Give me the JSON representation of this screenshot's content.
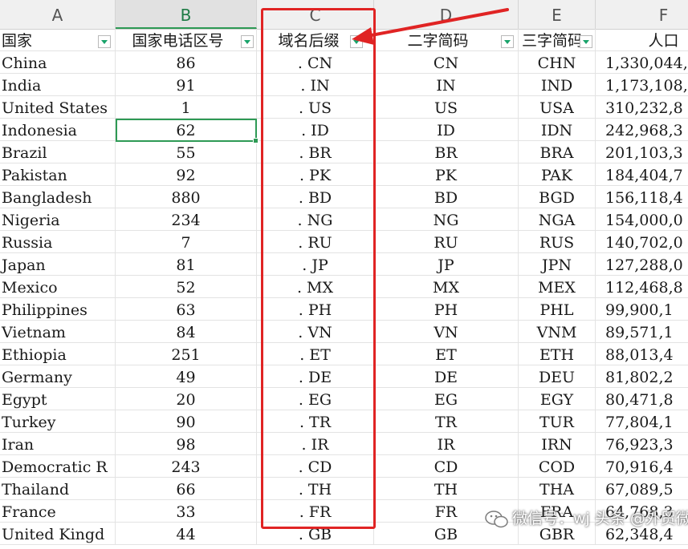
{
  "columns": [
    "A",
    "B",
    "C",
    "D",
    "E",
    "F"
  ],
  "selected_column": "B",
  "header_row": {
    "a": "国家",
    "b": "国家电话区号",
    "c": "域名后缀",
    "d": "二字简码",
    "e": "三字简码",
    "f": "人口"
  },
  "rows": [
    {
      "country": "China",
      "code": "86",
      "domain": ". CN",
      "iso2": "CN",
      "iso3": "CHN",
      "population": "1,330,044,"
    },
    {
      "country": "India",
      "code": "91",
      "domain": ". IN",
      "iso2": "IN",
      "iso3": "IND",
      "population": "1,173,108,"
    },
    {
      "country": "United States",
      "code": "1",
      "domain": ". US",
      "iso2": "US",
      "iso3": "USA",
      "population": "310,232,8"
    },
    {
      "country": "Indonesia",
      "code": "62",
      "domain": ". ID",
      "iso2": "ID",
      "iso3": "IDN",
      "population": "242,968,3"
    },
    {
      "country": "Brazil",
      "code": "55",
      "domain": ". BR",
      "iso2": "BR",
      "iso3": "BRA",
      "population": "201,103,3"
    },
    {
      "country": "Pakistan",
      "code": "92",
      "domain": ". PK",
      "iso2": "PK",
      "iso3": "PAK",
      "population": "184,404,7"
    },
    {
      "country": "Bangladesh",
      "code": "880",
      "domain": ". BD",
      "iso2": "BD",
      "iso3": "BGD",
      "population": "156,118,4"
    },
    {
      "country": "Nigeria",
      "code": "234",
      "domain": ". NG",
      "iso2": "NG",
      "iso3": "NGA",
      "population": "154,000,0"
    },
    {
      "country": "Russia",
      "code": "7",
      "domain": ". RU",
      "iso2": "RU",
      "iso3": "RUS",
      "population": "140,702,0"
    },
    {
      "country": "Japan",
      "code": "81",
      "domain": ". JP",
      "iso2": "JP",
      "iso3": "JPN",
      "population": "127,288,0"
    },
    {
      "country": "Mexico",
      "code": "52",
      "domain": ". MX",
      "iso2": "MX",
      "iso3": "MEX",
      "population": "112,468,8"
    },
    {
      "country": "Philippines",
      "code": "63",
      "domain": ". PH",
      "iso2": "PH",
      "iso3": "PHL",
      "population": "99,900,1"
    },
    {
      "country": "Vietnam",
      "code": "84",
      "domain": ". VN",
      "iso2": "VN",
      "iso3": "VNM",
      "population": "89,571,1"
    },
    {
      "country": "Ethiopia",
      "code": "251",
      "domain": ". ET",
      "iso2": "ET",
      "iso3": "ETH",
      "population": "88,013,4"
    },
    {
      "country": "Germany",
      "code": "49",
      "domain": ". DE",
      "iso2": "DE",
      "iso3": "DEU",
      "population": "81,802,2"
    },
    {
      "country": "Egypt",
      "code": "20",
      "domain": ". EG",
      "iso2": "EG",
      "iso3": "EGY",
      "population": "80,471,8"
    },
    {
      "country": "Turkey",
      "code": "90",
      "domain": ". TR",
      "iso2": "TR",
      "iso3": "TUR",
      "population": "77,804,1"
    },
    {
      "country": "Iran",
      "code": "98",
      "domain": ". IR",
      "iso2": "IR",
      "iso3": "IRN",
      "population": "76,923,3"
    },
    {
      "country": "Democratic R",
      "code": "243",
      "domain": ". CD",
      "iso2": "CD",
      "iso3": "COD",
      "population": "70,916,4"
    },
    {
      "country": "Thailand",
      "code": "66",
      "domain": ". TH",
      "iso2": "TH",
      "iso3": "THA",
      "population": "67,089,5"
    },
    {
      "country": "France",
      "code": "33",
      "domain": ". FR",
      "iso2": "FR",
      "iso3": "FRA",
      "population": "64,768,3"
    },
    {
      "country": "United Kingd",
      "code": "44",
      "domain": ". GB",
      "iso2": "GB",
      "iso3": "GBR",
      "population": "62,348,4"
    }
  ],
  "watermark": {
    "text": "微信号：wj 头条 @外贸微信",
    "icon": "wechat-icon"
  },
  "colors": {
    "header_bg": "#f0f0f0",
    "selection_green": "#2e9a55",
    "filter_arrow": "#1aa36b",
    "annotation_red": "#e02424"
  }
}
